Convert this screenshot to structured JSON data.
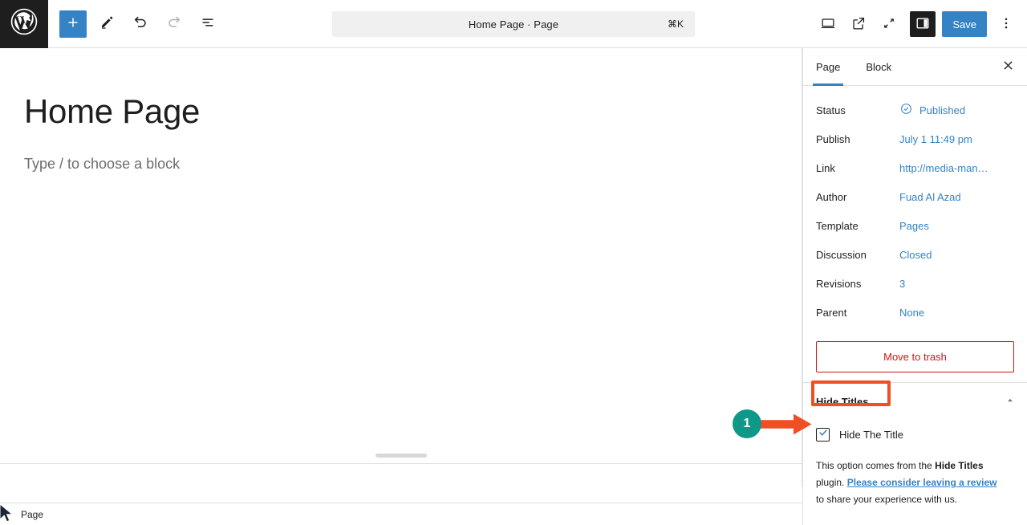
{
  "header": {
    "logo_icon": "wordpress-logo-icon",
    "add_block_label": "+",
    "tools": [
      {
        "name": "add-block-button",
        "icon": "plus-icon",
        "label": "Add block"
      },
      {
        "name": "edit-mode-button",
        "icon": "pencil-icon",
        "label": "Edit"
      },
      {
        "name": "undo-button",
        "icon": "undo-icon",
        "label": "Undo"
      },
      {
        "name": "redo-button",
        "icon": "redo-icon",
        "label": "Redo"
      },
      {
        "name": "list-view-button",
        "icon": "list-view-icon",
        "label": "Document Overview"
      }
    ],
    "command_bar": {
      "title": "Home Page · Page",
      "shortcut": "⌘K"
    },
    "right_tools": [
      {
        "name": "view-device-button",
        "icon": "desktop-icon",
        "label": "View"
      },
      {
        "name": "view-site-button",
        "icon": "external-link-icon",
        "label": "View site"
      },
      {
        "name": "zoom-out-button",
        "icon": "expand-icon",
        "label": "Zoom out"
      },
      {
        "name": "settings-sidebar-button",
        "icon": "sidebar-panel-icon",
        "label": "Settings"
      }
    ],
    "save_label": "Save",
    "more_options_icon": "three-dots-vertical-icon"
  },
  "canvas": {
    "post_title": "Home Page",
    "block_placeholder": "Type / to choose a block"
  },
  "status_bar": {
    "breadcrumb": "Page"
  },
  "sidebar": {
    "tabs": [
      {
        "label": "Page",
        "selected": true
      },
      {
        "label": "Block",
        "selected": false
      }
    ],
    "close_icon": "close-icon",
    "meta": [
      {
        "label": "Status",
        "value": "Published",
        "icon": "check-circle-icon"
      },
      {
        "label": "Publish",
        "value": "July 1 11:49 pm",
        "icon": ""
      },
      {
        "label": "Link",
        "value": "http://media-man…",
        "icon": ""
      },
      {
        "label": "Author",
        "value": "Fuad Al Azad",
        "icon": ""
      },
      {
        "label": "Template",
        "value": "Pages",
        "icon": ""
      },
      {
        "label": "Discussion",
        "value": "Closed",
        "icon": ""
      },
      {
        "label": "Revisions",
        "value": "3",
        "icon": ""
      },
      {
        "label": "Parent",
        "value": "None",
        "icon": ""
      }
    ],
    "trash_label": "Move to trash",
    "plugin_panel": {
      "title": "Hide Titles",
      "collapse_icon": "chevron-up-icon",
      "checkbox_label": "Hide The Title",
      "checkbox_checked": true,
      "help_prefix": "This option comes from the ",
      "help_plugin_name": "Hide Titles",
      "help_middle": " plugin. ",
      "help_link": "Please consider leaving a review",
      "help_suffix": " to share your experience with us."
    }
  },
  "annotations": {
    "step_badge": "1",
    "badge_color": "#0E9888",
    "arrow_color": "#F04E23",
    "box_color": "#F04E23"
  },
  "colors": {
    "accent_blue": "#3582C4",
    "dark": "#1E1E1E",
    "danger_red": "#CC1818"
  }
}
